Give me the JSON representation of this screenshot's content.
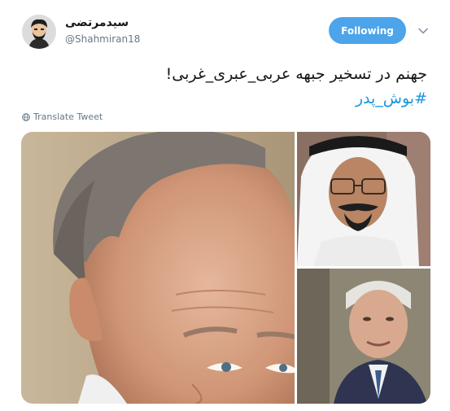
{
  "author": {
    "display_name": "سیدمرتضی",
    "handle": "@Shahmiran18",
    "avatar_icon": "avatar-cartoon-icon"
  },
  "header": {
    "follow_label": "Following",
    "menu_icon": "chevron-down-icon"
  },
  "tweet": {
    "text_line1": "جهنم در تسخیر جبهه عربی_عبری_غربی!",
    "hashtag": "#بوش_پدر",
    "translate_label": "Translate Tweet"
  },
  "colors": {
    "accent": "#4ca4ea",
    "hashtag": "#1b95e0",
    "muted": "#657786"
  },
  "media": {
    "photos": [
      {
        "name": "photo-older-man-closeup"
      },
      {
        "name": "photo-man-white-headdress"
      },
      {
        "name": "photo-elderly-man-suit"
      }
    ]
  }
}
